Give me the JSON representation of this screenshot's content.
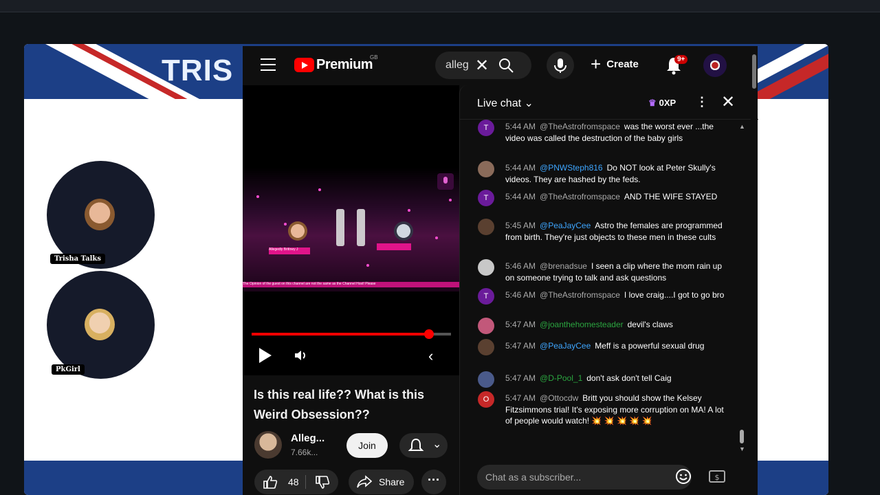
{
  "stream": {
    "banner_text": "TRIS",
    "guests": [
      {
        "tag": "Trisha Talks"
      },
      {
        "tag": "PkGirl"
      }
    ]
  },
  "youtube": {
    "logo_text": "Premium",
    "region": "GB",
    "search_value": "alleg",
    "create_label": "Create",
    "notification_badge": "9+",
    "video": {
      "title": "Is this real life?? What is this Weird Obsession??",
      "progress": 0.89,
      "ticker": "The Opinion of the guest on this channel are not the same as the Channel Host! Please",
      "left_tag": "Allegedly Brittney J"
    },
    "channel": {
      "name": "Alleg...",
      "subs": "7.66k...",
      "join_label": "Join"
    },
    "actions": {
      "like_count": "48",
      "share_label": "Share"
    },
    "chat": {
      "title": "Live chat",
      "xp": "0XP",
      "input_placeholder": "Chat as a subscriber...",
      "messages": [
        {
          "initial": "T",
          "avatar_color": "#6a1b9a",
          "time": "5:44 AM",
          "author": "@TheAstrofromspace",
          "style": "normal",
          "text": "was the worst ever ...the video was called the destruction of the baby girls"
        },
        {
          "initial": "",
          "avatar_color": "#8a6b5a",
          "time": "5:44 AM",
          "author": "@PNWSteph816",
          "style": "member",
          "text": "Do NOT look at Peter Skully's videos. They are hashed by the feds."
        },
        {
          "initial": "T",
          "avatar_color": "#6a1b9a",
          "time": "5:44 AM",
          "author": "@TheAstrofromspace",
          "style": "normal",
          "text": "AND THE WIFE STAYED"
        },
        {
          "initial": "",
          "avatar_color": "#5a4030",
          "time": "5:45 AM",
          "author": "@PeaJayCee",
          "style": "member",
          "text": "Astro the females are programmed from birth. They're just objects to these men in these cults"
        },
        {
          "initial": "",
          "avatar_color": "#c8c8c8",
          "time": "5:46 AM",
          "author": "@brenadsue",
          "style": "normal",
          "text": "I seen a clip where the mom rain up on someone trying to talk and ask questions"
        },
        {
          "initial": "T",
          "avatar_color": "#6a1b9a",
          "time": "5:46 AM",
          "author": "@TheAstrofromspace",
          "style": "normal",
          "text": "I love craig....I got to go bro"
        },
        {
          "initial": "",
          "avatar_color": "#c2587a",
          "time": "5:47 AM",
          "author": "@joanthehomesteader",
          "style": "green",
          "text": "devil's claws"
        },
        {
          "initial": "",
          "avatar_color": "#5a4030",
          "time": "5:47 AM",
          "author": "@PeaJayCee",
          "style": "member",
          "text": "Meff is a powerful sexual drug"
        },
        {
          "initial": "",
          "avatar_color": "#4a5a8a",
          "time": "5:47 AM",
          "author": "@D-Pool_1",
          "style": "green",
          "text": "don't ask don't tell Caig"
        },
        {
          "initial": "O",
          "avatar_color": "#c62828",
          "time": "5:47 AM",
          "author": "@Ottocdw",
          "style": "normal",
          "text": "Britt you should show the Kelsey Fitzsimmons trial! It's exposing more corruption on MA! A lot of people would watch! 💥 💥 💥 💥 💥"
        }
      ]
    }
  },
  "colors": {
    "youtube_red": "#ff0000",
    "bg_dark": "#0f0f0f",
    "member_blue": "#3ea6ff",
    "green_name": "#2ba640"
  }
}
